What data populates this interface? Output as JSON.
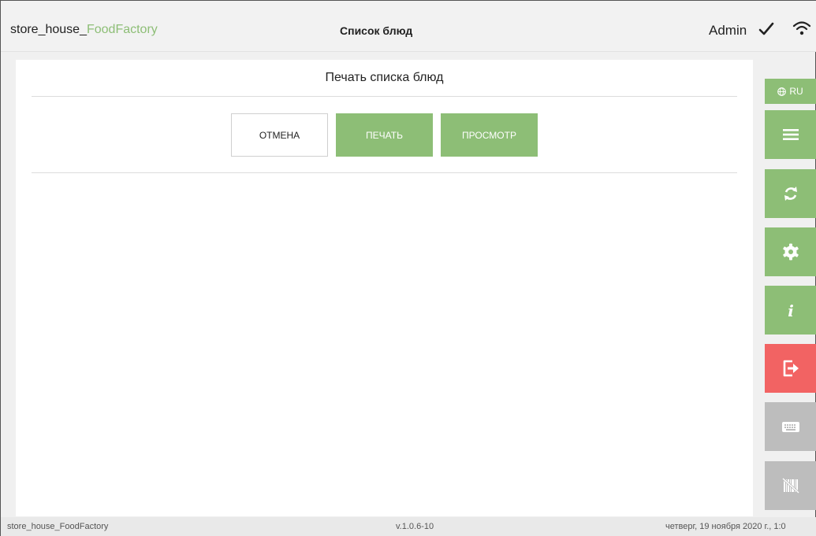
{
  "header": {
    "brand_main": "store_house_",
    "brand_accent": "FoodFactory",
    "page_title": "Список блюд",
    "user": "Admin"
  },
  "dialog": {
    "title": "Печать списка блюд",
    "cancel_label": "ОТМЕНА",
    "print_label": "ПЕЧАТЬ",
    "preview_label": "ПРОСМОТР"
  },
  "side_panel": {
    "language": "RU",
    "buttons": [
      {
        "icon": "menu-icon",
        "color": "#8dbe76"
      },
      {
        "icon": "refresh-icon",
        "color": "#8dbe76"
      },
      {
        "icon": "gear-icon",
        "color": "#8dbe76"
      },
      {
        "icon": "info-icon",
        "color": "#8dbe76"
      },
      {
        "icon": "logout-icon",
        "color": "#f26363"
      },
      {
        "icon": "keyboard-icon",
        "color": "#bdbdbd"
      },
      {
        "icon": "barcode-off-icon",
        "color": "#bdbdbd"
      }
    ]
  },
  "footer": {
    "app_name": "store_house_FoodFactory",
    "version": "v.1.0.6-10",
    "datetime": "четверг, 19 ноября 2020 г., 1:0"
  },
  "colors": {
    "accent": "#8dbe76",
    "danger": "#f26363",
    "disabled": "#bdbdbd"
  }
}
